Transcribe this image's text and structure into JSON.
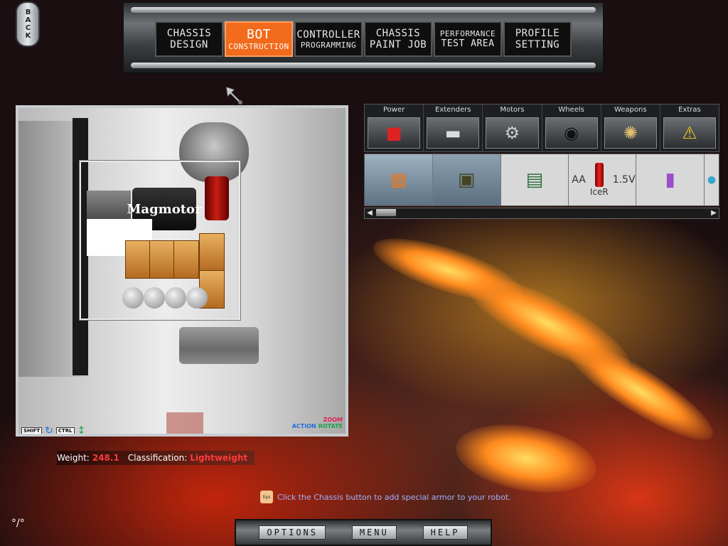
{
  "back_label": "BACK",
  "nav": [
    {
      "l1": "CHASSIS",
      "l2": "DESIGN",
      "active": false
    },
    {
      "l1": "BOT",
      "l2": "CONSTRUCTION",
      "active": true
    },
    {
      "l1": "CONTROLLER",
      "l2": "PROGRAMMING",
      "active": false
    },
    {
      "l1": "CHASSIS",
      "l2": "PAINT JOB",
      "active": false
    },
    {
      "l1": "PERFORMANCE",
      "l2": "TEST AREA",
      "active": false
    },
    {
      "l1": "PROFILE",
      "l2": "SETTING",
      "active": false
    }
  ],
  "viewport": {
    "motor_label": "Magmotor",
    "hint_shift": "SHIFT",
    "hint_ctrl": "CTRL",
    "hint_action": "ACTION",
    "hint_zoom": "ZOOM",
    "hint_rotate": "ROTATE"
  },
  "categories": [
    {
      "label": "Power",
      "icon": "battery-box-icon"
    },
    {
      "label": "Extenders",
      "icon": "bar-icon"
    },
    {
      "label": "Motors",
      "icon": "motor-icon"
    },
    {
      "label": "Wheels",
      "icon": "wheel-icon"
    },
    {
      "label": "Weapons",
      "icon": "saw-icon"
    },
    {
      "label": "Extras",
      "icon": "hazard-icon"
    }
  ],
  "items": {
    "aa_label": "AA",
    "voltage": "1.5V",
    "brand": "IceR"
  },
  "stats": {
    "weight_label": "Weight:",
    "weight_value": "248.1",
    "class_label": "Classification:",
    "class_value": "Lightweight"
  },
  "tip": {
    "icon_text": "tips",
    "text": "Click the Chassis button to add special armor to your robot."
  },
  "bottom": {
    "options": "OPTIONS",
    "menu": "MENU",
    "help": "HELP"
  }
}
